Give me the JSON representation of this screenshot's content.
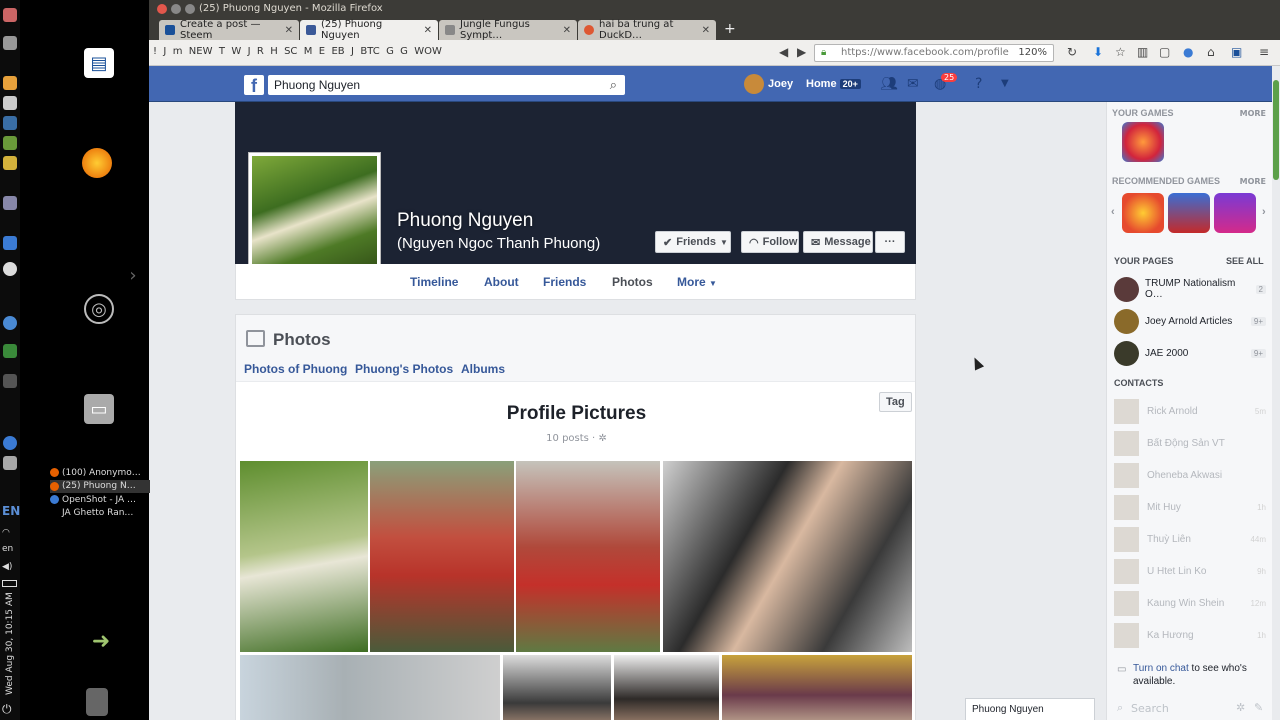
{
  "os": {
    "clock": "Wed Aug 30, 10:15 AM",
    "lang": "EN",
    "lang_small": "en",
    "windows": [
      {
        "label": "(100) Anonymo…",
        "color": "#e66000"
      },
      {
        "label": "(25) Phuong N…",
        "color": "#e66000"
      },
      {
        "label": "OpenShot - JA …",
        "color": "#3b7bd4"
      },
      {
        "label": "JA Ghetto Ran…",
        "color": "#2a2a2a"
      }
    ]
  },
  "browser": {
    "window_title": "(25) Phuong Nguyen - Mozilla Firefox",
    "tabs": [
      {
        "label": "Create a post — Steem",
        "color": "#1a5099"
      },
      {
        "label": "(25) Phuong Nguyen",
        "color": "#3b5998"
      },
      {
        "label": "Jungle Fungus Sympt…",
        "color": "#888888"
      },
      {
        "label": "hai ba trung at DuckD…",
        "color": "#de5833"
      }
    ],
    "bookmarks": [
      "!",
      "J",
      "m",
      "NEW",
      "T",
      "W",
      "J",
      "R",
      "H",
      "SC",
      "M",
      "E",
      "EB",
      "J",
      "BTC",
      "G",
      "G",
      "WOW"
    ],
    "url": "https://www.facebook.com/profile",
    "zoom": "120%"
  },
  "facebook": {
    "search_value": "Phuong Nguyen",
    "user_name": "Joey",
    "home_label": "Home",
    "home_count": "20+",
    "notif_count": "25",
    "logo": "f",
    "profile": {
      "name": "Phuong Nguyen",
      "alt_name": "(Nguyen Ngoc Thanh Phuong)",
      "friends_btn": "Friends",
      "follow_btn": "Follow",
      "message_btn": "Message",
      "more_btn": "···"
    },
    "profile_tabs": [
      "Timeline",
      "About",
      "Friends",
      "Photos",
      "More"
    ],
    "photos_section": {
      "title": "Photos",
      "links": [
        "Photos of Phuong",
        "Phuong's Photos",
        "Albums"
      ],
      "album_title": "Profile Pictures",
      "album_meta": "10 posts ·",
      "tag_btn": "Tag"
    },
    "sidebar": {
      "your_games": "YOUR GAMES",
      "more": "MORE",
      "recommended_games": "RECOMMENDED GAMES",
      "your_pages": "YOUR PAGES",
      "see_all": "SEE ALL",
      "pages": [
        {
          "name": "TRUMP Nationalism O…",
          "badge": "2",
          "color": "#5a3a3a"
        },
        {
          "name": "Joey Arnold Articles",
          "badge": "9+",
          "color": "#8a6a2a"
        },
        {
          "name": "JAE 2000",
          "badge": "9+",
          "color": "#3a3a2a"
        }
      ],
      "contacts_label": "CONTACTS",
      "contacts": [
        {
          "name": "Rick Arnold",
          "ago": "5m"
        },
        {
          "name": "Bất Động Sản VT",
          "ago": ""
        },
        {
          "name": "Oheneba Akwasi",
          "ago": ""
        },
        {
          "name": "Mit Huy",
          "ago": "1h"
        },
        {
          "name": "Thuỳ Liên",
          "ago": "44m"
        },
        {
          "name": "U Htet Lin Ko",
          "ago": "9h"
        },
        {
          "name": "Kaung Win Shein",
          "ago": "12m"
        },
        {
          "name": "Ka Hương",
          "ago": "1h"
        }
      ],
      "chat_link": "Turn on chat",
      "chat_text": " to see who's available.",
      "search_placeholder": "Search"
    },
    "chat_tab": "Phuong Nguyen"
  }
}
